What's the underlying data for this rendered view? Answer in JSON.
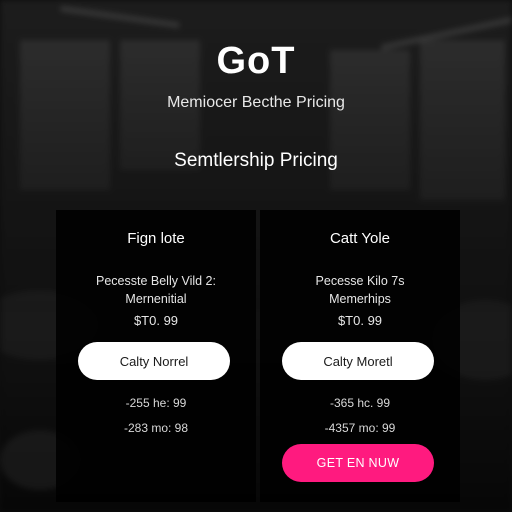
{
  "header": {
    "logo": "GoT",
    "tagline": "Memiocer Becthe Pricing",
    "section_title": "Semtlership Pricing"
  },
  "plans": [
    {
      "name": "Fign lote",
      "desc_line1": "Pecesste Belly Vild 2:",
      "desc_line2": "Mernenitial",
      "price": "$T0. 99",
      "button_label": "Calty Norrel",
      "detail_line1": "-255 he: 99",
      "detail_line2": "-283 mo: 98"
    },
    {
      "name": "Catt Yole",
      "desc_line1": "Pecesse Kilo 7s",
      "desc_line2": "Memerhips",
      "price": "$T0. 99",
      "button_label": "Calty Moretl",
      "detail_line1": "-365 hc. 99",
      "detail_line2": "-4357 mo: 99",
      "cta_label": "GET EN NUW"
    }
  ],
  "colors": {
    "accent": "#ff1a7f",
    "card_bg": "#000000",
    "button_bg": "#ffffff"
  }
}
